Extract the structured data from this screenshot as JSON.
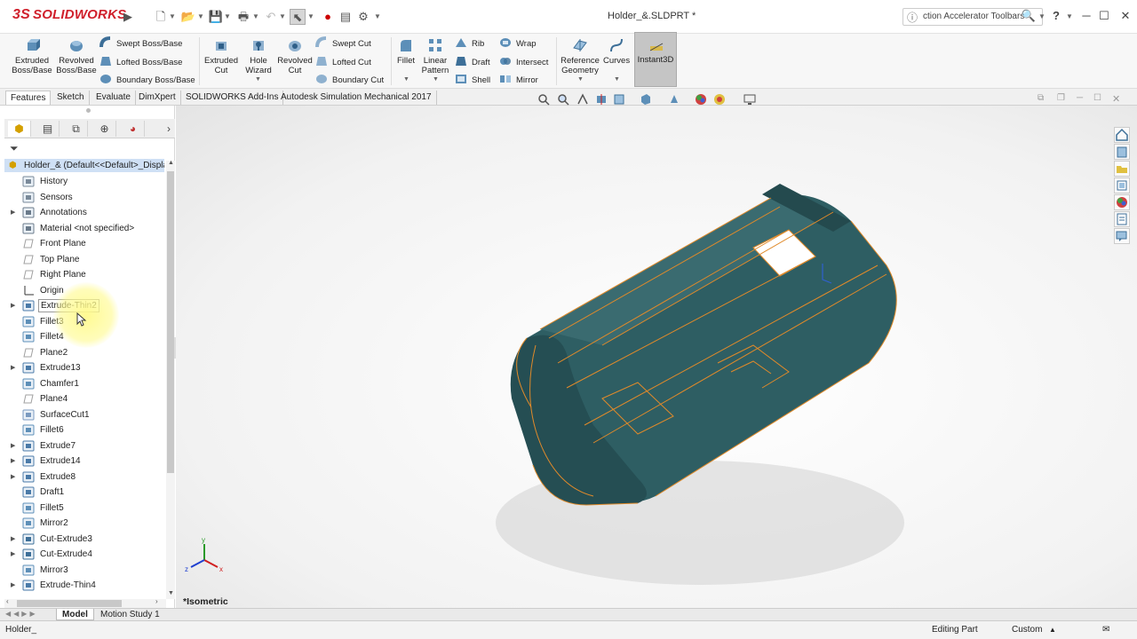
{
  "app": {
    "logo_text": "SOLIDWORKS",
    "logo_prefix": "3S",
    "document_title": "Holder_&.SLDPRT *",
    "search_text": "ction Accelerator Toolbars",
    "help_label": "?",
    "colors": {
      "brand": "#d0202c",
      "part_fill": "#2e5e63",
      "edge_highlight": "#e08a2a",
      "tree_selection": "#cfe0f5"
    }
  },
  "quick_access": [
    "new-icon",
    "open-icon",
    "save-icon",
    "print-icon",
    "undo-icon",
    "select-icon",
    "rebuild-icon",
    "file-properties-icon",
    "options-icon"
  ],
  "ribbon": {
    "extruded_boss": "Extruded\nBoss/Base",
    "extruded_boss_l1": "Extruded",
    "extruded_boss_l2": "Boss/Base",
    "revolved_boss_l1": "Revolved",
    "revolved_boss_l2": "Boss/Base",
    "swept_boss": "Swept Boss/Base",
    "lofted_boss": "Lofted Boss/Base",
    "boundary_boss": "Boundary Boss/Base",
    "extruded_cut_l1": "Extruded",
    "extruded_cut_l2": "Cut",
    "hole_wizard_l1": "Hole",
    "hole_wizard_l2": "Wizard",
    "revolved_cut_l1": "Revolved",
    "revolved_cut_l2": "Cut",
    "swept_cut": "Swept Cut",
    "lofted_cut": "Lofted Cut",
    "boundary_cut": "Boundary Cut",
    "fillet": "Fillet",
    "linear_pattern_l1": "Linear",
    "linear_pattern_l2": "Pattern",
    "rib": "Rib",
    "draft": "Draft",
    "shell": "Shell",
    "wrap": "Wrap",
    "intersect": "Intersect",
    "mirror": "Mirror",
    "reference_geometry_l1": "Reference",
    "reference_geometry_l2": "Geometry",
    "curves": "Curves",
    "instant3d": "Instant3D"
  },
  "command_tabs": [
    "Features",
    "Sketch",
    "Evaluate",
    "DimXpert",
    "SOLIDWORKS Add-Ins",
    "Autodesk Simulation Mechanical 2017"
  ],
  "feature_tree": {
    "root": "Holder_&  (Default<<Default>_Displa",
    "items": [
      {
        "label": "History",
        "icon": "history-icon",
        "expandable": false
      },
      {
        "label": "Sensors",
        "icon": "sensors-icon",
        "expandable": false
      },
      {
        "label": "Annotations",
        "icon": "annotations-icon",
        "expandable": true
      },
      {
        "label": "Material <not specified>",
        "icon": "material-icon",
        "expandable": false
      },
      {
        "label": "Front Plane",
        "icon": "plane-icon",
        "expandable": false
      },
      {
        "label": "Top Plane",
        "icon": "plane-icon",
        "expandable": false
      },
      {
        "label": "Right Plane",
        "icon": "plane-icon",
        "expandable": false
      },
      {
        "label": "Origin",
        "icon": "origin-icon",
        "expandable": false
      },
      {
        "label": "Extrude-Thin2",
        "icon": "extrude-icon",
        "expandable": true
      },
      {
        "label": "Fillet3",
        "icon": "fillet-icon",
        "expandable": false
      },
      {
        "label": "Fillet4",
        "icon": "fillet-icon",
        "expandable": false
      },
      {
        "label": "Plane2",
        "icon": "plane-icon",
        "expandable": false
      },
      {
        "label": "Extrude13",
        "icon": "extrude-icon",
        "expandable": true
      },
      {
        "label": "Chamfer1",
        "icon": "chamfer-icon",
        "expandable": false
      },
      {
        "label": "Plane4",
        "icon": "plane-icon",
        "expandable": false
      },
      {
        "label": "SurfaceCut1",
        "icon": "surface-cut-icon",
        "expandable": false
      },
      {
        "label": "Fillet6",
        "icon": "fillet-icon",
        "expandable": false
      },
      {
        "label": "Extrude7",
        "icon": "extrude-icon",
        "expandable": true
      },
      {
        "label": "Extrude14",
        "icon": "extrude-icon",
        "expandable": true
      },
      {
        "label": "Extrude8",
        "icon": "extrude-icon",
        "expandable": true
      },
      {
        "label": "Draft1",
        "icon": "draft-icon",
        "expandable": false
      },
      {
        "label": "Fillet5",
        "icon": "fillet-icon",
        "expandable": false
      },
      {
        "label": "Mirror2",
        "icon": "mirror-icon",
        "expandable": false
      },
      {
        "label": "Cut-Extrude3",
        "icon": "cut-extrude-icon",
        "expandable": true
      },
      {
        "label": "Cut-Extrude4",
        "icon": "cut-extrude-icon",
        "expandable": true
      },
      {
        "label": "Mirror3",
        "icon": "mirror-icon",
        "expandable": false
      },
      {
        "label": "Extrude-Thin4",
        "icon": "extrude-icon",
        "expandable": true
      }
    ]
  },
  "viewport": {
    "view_name": "*Isometric",
    "triad": {
      "x": "x",
      "y": "y",
      "z": "z"
    }
  },
  "bottom_tabs": [
    "Model",
    "Motion Study 1"
  ],
  "status": {
    "left": "Holder_",
    "mode": "Editing Part",
    "units": "Custom"
  }
}
